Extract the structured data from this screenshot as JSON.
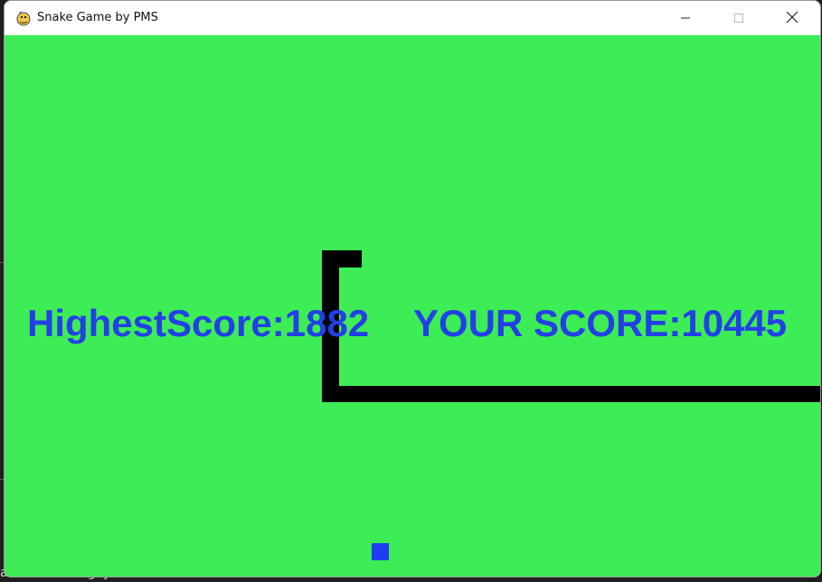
{
  "window": {
    "title": "Snake Game by PMS",
    "app_icon": "pygame-snake-icon",
    "controls": [
      "minimize-icon",
      "maximize-icon",
      "close-icon"
    ]
  },
  "game": {
    "background_color": "#3ded55",
    "snake_color": "#000000",
    "food_color": "#1d3ff0",
    "text_color": "#2340e6",
    "highest_score_text": "HighestScore:1882",
    "your_score_text": "YOUR SCORE:10445"
  },
  "desktop": {
    "partial_text": "akeGameUsingPython"
  }
}
